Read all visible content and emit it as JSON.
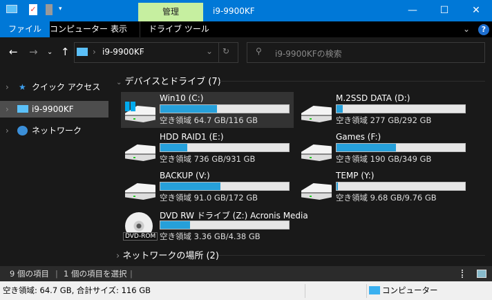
{
  "titlebar": {
    "manage_tab": "管理",
    "title": "i9-9900KF",
    "minimize": "—",
    "maximize": "☐",
    "close": "✕"
  },
  "ribbon": {
    "tabs": [
      "ファイル",
      "コンピューター",
      "表示",
      "ドライブ ツール"
    ],
    "help": "?"
  },
  "nav": {
    "address": "i9-9900KF",
    "search_placeholder": "i9-9900KFの検索"
  },
  "sidebar": {
    "items": [
      {
        "label": "クイック アクセス"
      },
      {
        "label": "i9-9900KF"
      },
      {
        "label": "ネットワーク"
      }
    ]
  },
  "main": {
    "devices_header": "デバイスとドライブ (7)",
    "network_header": "ネットワークの場所 (2)",
    "drives": [
      {
        "name": "Win10 (C:)",
        "free": "空き領域 64.7 GB/116 GB",
        "used_fraction": 0.44,
        "icon": "windows-drive",
        "selected": true
      },
      {
        "name": "M.2SSD DATA (D:)",
        "free": "空き領域 277 GB/292 GB",
        "used_fraction": 0.05,
        "icon": "hdd"
      },
      {
        "name": "HDD RAID1 (E:)",
        "free": "空き領域 736 GB/931 GB",
        "used_fraction": 0.21,
        "icon": "hdd"
      },
      {
        "name": "Games (F:)",
        "free": "空き領域 190 GB/349 GB",
        "used_fraction": 0.46,
        "icon": "hdd"
      },
      {
        "name": "BACKUP (V:)",
        "free": "空き領域 91.0 GB/172 GB",
        "used_fraction": 0.47,
        "icon": "hdd"
      },
      {
        "name": "TEMP (Y:)",
        "free": "空き領域 9.68 GB/9.76 GB",
        "used_fraction": 0.01,
        "icon": "hdd"
      },
      {
        "name": "DVD RW ドライブ (Z:) Acronis Media",
        "free": "空き領域 3.36 GB/4.38 GB",
        "used_fraction": 0.23,
        "icon": "dvd",
        "icon_label": "DVD-ROM"
      }
    ]
  },
  "status": {
    "items": "9 個の項目",
    "selected": "1 個の項目を選択"
  },
  "bottom": {
    "details": "空き領域: 64.7 GB, 合計サイズ: 116 GB",
    "location": "コンピューター"
  },
  "colors": {
    "accent": "#0078d7",
    "bar_fill": "#26a0da",
    "manage": "#c6efa0"
  }
}
